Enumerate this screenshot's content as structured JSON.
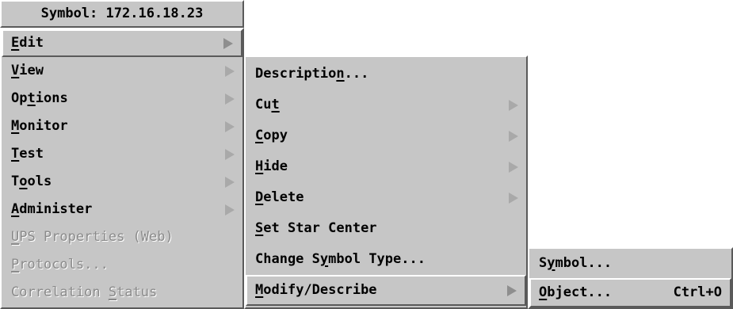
{
  "title": "Symbol: 172.16.18.23",
  "main_menu": [
    {
      "pre": "",
      "u": "E",
      "post": "dit",
      "submenu": true,
      "active": true,
      "disabled": false
    },
    {
      "pre": "",
      "u": "V",
      "post": "iew",
      "submenu": true,
      "active": false,
      "disabled": false
    },
    {
      "pre": "Op",
      "u": "t",
      "post": "ions",
      "submenu": true,
      "active": false,
      "disabled": false
    },
    {
      "pre": "",
      "u": "M",
      "post": "onitor",
      "submenu": true,
      "active": false,
      "disabled": false
    },
    {
      "pre": "",
      "u": "T",
      "post": "est",
      "submenu": true,
      "active": false,
      "disabled": false
    },
    {
      "pre": "T",
      "u": "o",
      "post": "ols",
      "submenu": true,
      "active": false,
      "disabled": false
    },
    {
      "pre": "",
      "u": "A",
      "post": "dminister",
      "submenu": true,
      "active": false,
      "disabled": false
    },
    {
      "pre": "",
      "u": "U",
      "post": "PS Properties (Web)",
      "submenu": false,
      "active": false,
      "disabled": true
    },
    {
      "pre": "",
      "u": "P",
      "post": "rotocols...",
      "submenu": false,
      "active": false,
      "disabled": true
    },
    {
      "pre": "Correlation ",
      "u": "S",
      "post": "tatus",
      "submenu": false,
      "active": false,
      "disabled": true
    }
  ],
  "edit_menu": [
    {
      "pre": "Descriptio",
      "u": "n",
      "post": "...",
      "submenu": false,
      "active": false
    },
    {
      "pre": "Cu",
      "u": "t",
      "post": "",
      "submenu": true,
      "active": false
    },
    {
      "pre": "",
      "u": "C",
      "post": "opy",
      "submenu": true,
      "active": false
    },
    {
      "pre": "",
      "u": "H",
      "post": "ide",
      "submenu": true,
      "active": false
    },
    {
      "pre": "",
      "u": "D",
      "post": "elete",
      "submenu": true,
      "active": false
    },
    {
      "pre": "",
      "u": "S",
      "post": "et Star Center",
      "submenu": false,
      "active": false
    },
    {
      "pre": "Change S",
      "u": "y",
      "post": "mbol Type...",
      "submenu": false,
      "active": false
    },
    {
      "pre": "",
      "u": "M",
      "post": "odify/Describe",
      "submenu": true,
      "active": true
    }
  ],
  "modify_menu": [
    {
      "pre": "S",
      "u": "y",
      "post": "mbol...",
      "accel": "",
      "active": false
    },
    {
      "pre": "",
      "u": "O",
      "post": "bject...",
      "accel": "Ctrl+O",
      "active": true
    }
  ]
}
